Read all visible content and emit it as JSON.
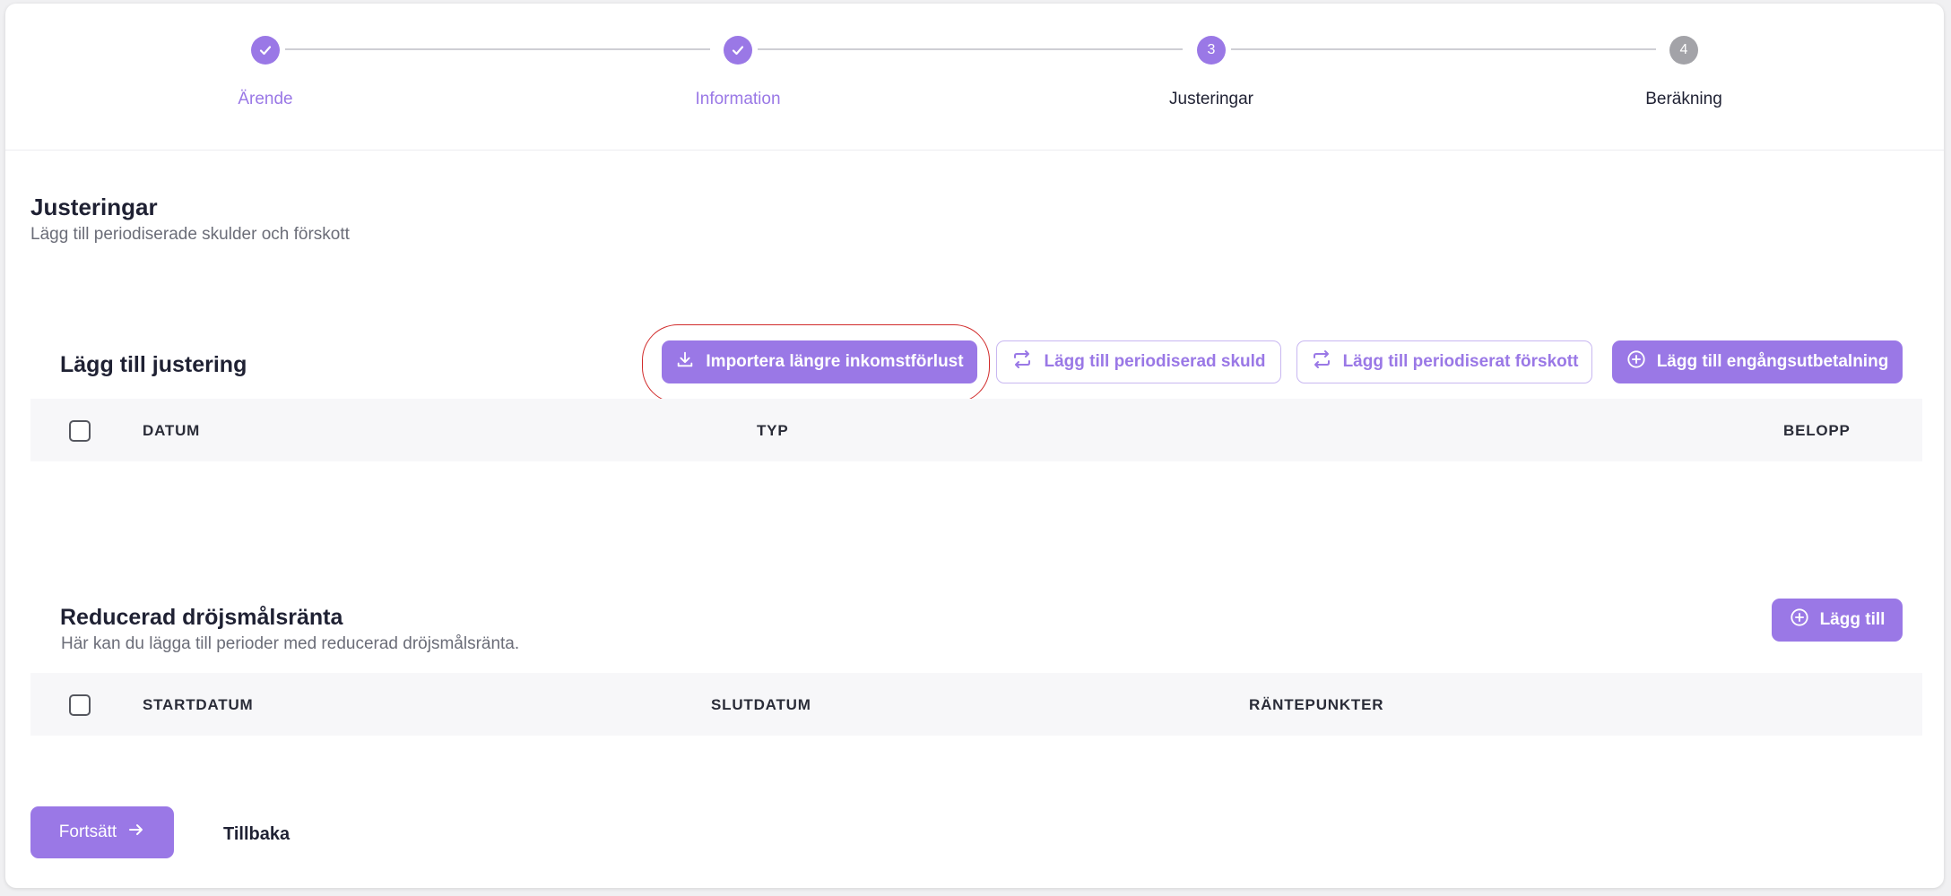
{
  "stepper": {
    "steps": [
      {
        "label": "Ärende",
        "state": "done"
      },
      {
        "label": "Information",
        "state": "done"
      },
      {
        "label": "Justeringar",
        "number": "3",
        "state": "current"
      },
      {
        "label": "Beräkning",
        "number": "4",
        "state": "todo"
      }
    ]
  },
  "page": {
    "title": "Justeringar",
    "subtitle": "Lägg till periodiserade skulder och förskott"
  },
  "adjustments": {
    "title": "Lägg till justering",
    "buttons": {
      "import": "Importera längre inkomstförlust",
      "add_debt": "Lägg till periodiserad skuld",
      "add_advance": "Lägg till periodiserat förskott",
      "add_one_time": "Lägg till engångsutbetalning"
    },
    "columns": [
      "DATUM",
      "TYP",
      "BELOPP"
    ]
  },
  "reduced_interest": {
    "title": "Reducerad dröjsmålsränta",
    "subtitle": "Här kan du lägga till perioder med reducerad dröjsmålsränta.",
    "add_label": "Lägg till",
    "columns": [
      "STARTDATUM",
      "SLUTDATUM",
      "RÄNTEPUNKTER"
    ]
  },
  "footer": {
    "continue_label": "Fortsätt",
    "back_label": "Tillbaka"
  },
  "colors": {
    "accent": "#9a78e6",
    "highlight": "#d12b2b",
    "inactive": "#a3a3a8"
  }
}
